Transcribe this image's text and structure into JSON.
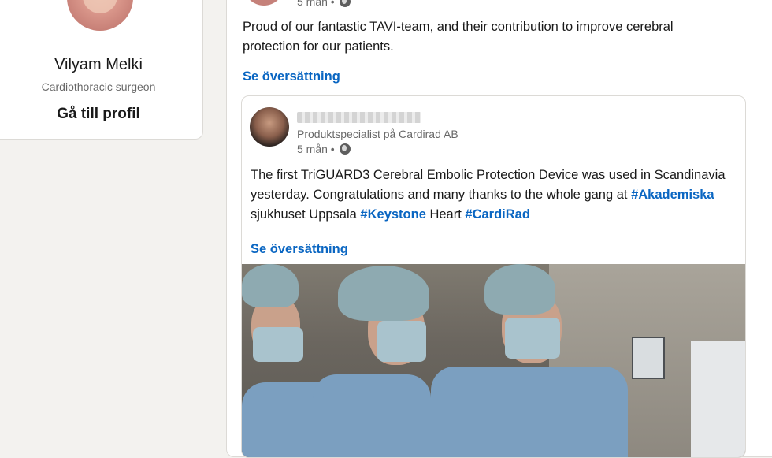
{
  "profile": {
    "name": "Vilyam Melki",
    "title": "Cardiothoracic surgeon",
    "link_label": "Gå till profil"
  },
  "post": {
    "time": "5 mån •",
    "text": "Proud of our fantastic TAVI-team, and their contribution to improve cerebral protection for our patients.",
    "translate_label": "Se översättning"
  },
  "shared": {
    "role": "Produktspecialist på Cardirad AB",
    "time": "5 mån •",
    "text_1": "The first TriGUARD3 Cerebral Embolic Protection Device was used in Scandinavia yesterday. Congratulations and many thanks to the whole gang at ",
    "tag_1": "#Akademiska",
    "text_2": " sjukhuset Uppsala ",
    "tag_2": "#Keystone",
    "text_3": " Heart ",
    "tag_3": "#CardiRad",
    "translate_label": "Se översättning"
  },
  "colors": {
    "link": "#0a66c2",
    "background": "#f3f2ef"
  },
  "icons": {
    "visibility": "globe-icon"
  }
}
